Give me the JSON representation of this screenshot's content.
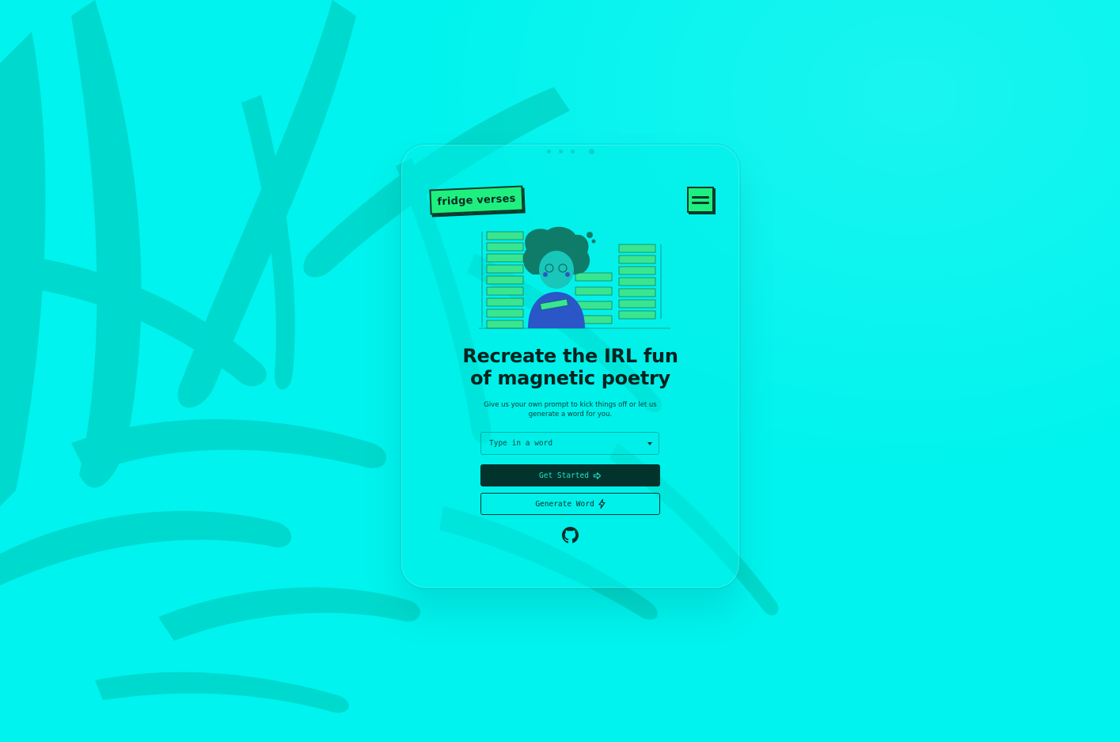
{
  "app": {
    "logo_text": "fridge verses"
  },
  "hero": {
    "headline_line1": "Recreate the IRL fun",
    "headline_line2": "of magnetic poetry",
    "description": "Give us your own prompt to kick things off or let us generate a word for you."
  },
  "form": {
    "word_placeholder": "Type in a word",
    "get_started_label": "Get Started",
    "generate_word_label": "Generate Word"
  },
  "icons": {
    "menu": "hamburger-menu-icon",
    "dropdown": "chevron-down-icon",
    "get_started": "arrow-right-icon",
    "generate": "lightning-bolt-icon",
    "footer": "github-icon"
  },
  "colors": {
    "background": "#00f4ee",
    "accent_green": "#1ef07f",
    "dark_teal": "#03332d",
    "text_dark": "#04231f"
  }
}
